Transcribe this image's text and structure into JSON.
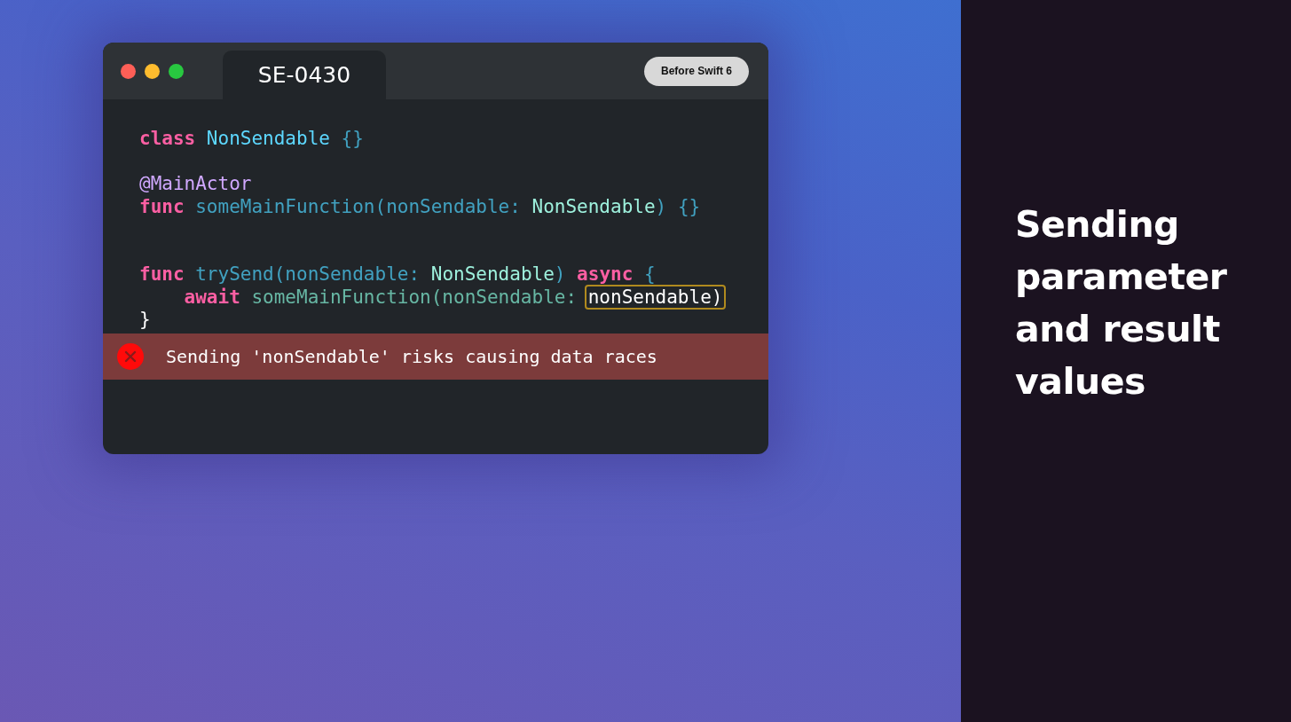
{
  "window": {
    "tab": {
      "label": "SE-0430",
      "selected": true
    },
    "badge": "Before Swift 6"
  },
  "code": [
    {
      "kind": "code",
      "indented": false,
      "tokens": [
        {
          "kind": "keyword",
          "text": "class "
        },
        {
          "kind": "type_decl",
          "text": "NonSendable "
        },
        {
          "kind": "call",
          "text": "{}"
        }
      ]
    },
    {
      "kind": "blank"
    },
    {
      "kind": "code",
      "indented": false,
      "tokens": [
        {
          "kind": "attribute",
          "text": "@MainActor"
        }
      ]
    },
    {
      "kind": "code",
      "indented": false,
      "tokens": [
        {
          "kind": "keyword",
          "text": "func "
        },
        {
          "kind": "call",
          "text": "someMainFunction(nonSendable: "
        },
        {
          "kind": "type_ref",
          "text": "NonSendable"
        },
        {
          "kind": "call",
          "text": ") {}"
        }
      ]
    },
    {
      "kind": "blank"
    },
    {
      "kind": "blank"
    },
    {
      "kind": "code",
      "indented": false,
      "tokens": [
        {
          "kind": "keyword",
          "text": "func "
        },
        {
          "kind": "call",
          "text": "trySend(nonSendable: "
        },
        {
          "kind": "type_ref",
          "text": "NonSendable"
        },
        {
          "kind": "call",
          "text": ") "
        },
        {
          "kind": "keyword",
          "text": "async "
        },
        {
          "kind": "call",
          "text": "{"
        }
      ]
    },
    {
      "kind": "code",
      "indented": true,
      "tokens": [
        {
          "kind": "keyword",
          "text": "await "
        },
        {
          "kind": "muted",
          "text": "someMainFunction(nonSendable: "
        },
        {
          "kind": "highlight",
          "text": "nonSendable)"
        }
      ]
    },
    {
      "kind": "code",
      "indented": false,
      "tokens": [
        {
          "kind": "plain",
          "text": "}"
        }
      ]
    }
  ],
  "error": {
    "message": "Sending 'nonSendable' risks causing data races"
  },
  "slide_title": "Sending parameter and result values"
}
